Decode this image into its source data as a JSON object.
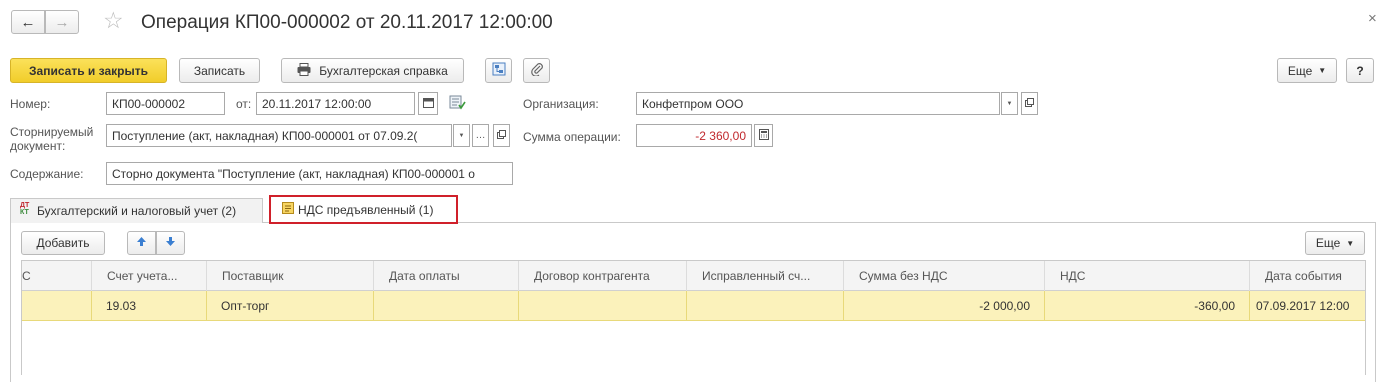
{
  "window": {
    "title": "Операция КП00-000002 от 20.11.2017 12:00:00",
    "close_glyph": "×",
    "back_glyph": "←",
    "forward_glyph": "→",
    "star_glyph": "☆"
  },
  "toolbar": {
    "save_close_label": "Записать и закрыть",
    "save_label": "Записать",
    "report_label": "Бухгалтерская справка",
    "more_label": "Еще",
    "help_label": "?"
  },
  "form": {
    "number_label": "Номер:",
    "number_value": "КП00-000002",
    "date_label": "от:",
    "date_value": "20.11.2017 12:00:00",
    "org_label": "Организация:",
    "org_value": "Конфетпром ООО",
    "storno_label_line1": "Сторнируемый",
    "storno_label_line2": "документ:",
    "storno_value": "Поступление (акт, накладная) КП00-000001 от 07.09.2(",
    "sum_label": "Сумма операции:",
    "sum_value": "-2 360,00",
    "content_label": "Содержание:",
    "content_value": "Сторно документа \"Поступление (акт, накладная) КП00-000001 о"
  },
  "tabs": [
    {
      "icon_text": "ДТ КТ",
      "label": "Бухгалтерский и налоговый учет (2)"
    },
    {
      "label": "НДС предъявленный (1)"
    }
  ],
  "table_toolbar": {
    "add_label": "Добавить",
    "more_label": "Еще"
  },
  "table": {
    "columns": [
      "С",
      "Счет учета...",
      "Поставщик",
      "Дата оплаты",
      "Договор контрагента",
      "Исправленный сч...",
      "Сумма без НДС",
      "НДС",
      "Дата события"
    ],
    "rows": [
      [
        "",
        "19.03",
        "Опт-торг",
        "",
        "",
        "",
        "-2 000,00",
        "-360,00",
        "07.09.2017 12:00"
      ]
    ]
  },
  "colors": {
    "accent_yellow": "#f5d33a",
    "selected_row": "#fbf2bb",
    "highlight_red": "#d0202a",
    "negative_red": "#c0282d"
  },
  "icons": {
    "lock": "lock-icon",
    "calendar": "calendar-icon",
    "printer": "printer-icon",
    "structure": "structure-icon",
    "paperclip": "paperclip-icon"
  }
}
